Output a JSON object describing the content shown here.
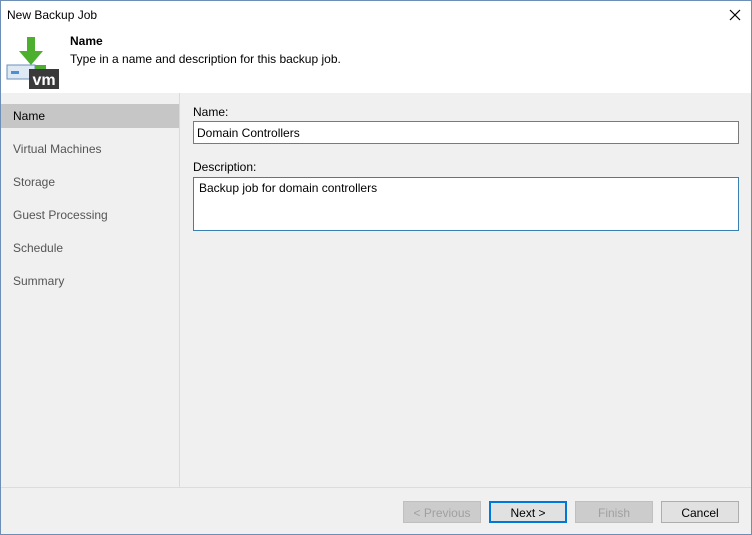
{
  "window": {
    "title": "New Backup Job"
  },
  "header": {
    "title": "Name",
    "subtitle": "Type in a name and description for this backup job."
  },
  "sidebar": {
    "items": [
      {
        "label": "Name",
        "active": true
      },
      {
        "label": "Virtual Machines",
        "active": false
      },
      {
        "label": "Storage",
        "active": false
      },
      {
        "label": "Guest Processing",
        "active": false
      },
      {
        "label": "Schedule",
        "active": false
      },
      {
        "label": "Summary",
        "active": false
      }
    ]
  },
  "form": {
    "name_label": "Name:",
    "name_value": "Domain Controllers",
    "description_label": "Description:",
    "description_value": "Backup job for domain controllers"
  },
  "footer": {
    "previous_label": "< Previous",
    "next_label": "Next >",
    "finish_label": "Finish",
    "cancel_label": "Cancel"
  },
  "colors": {
    "accent": "#0078d7",
    "logo_green": "#4caf2e",
    "logo_vm_bg": "#3a3a3a",
    "sidebar_active": "#c6c6c6"
  },
  "icons": {
    "logo": "veeam-vm-backup-icon",
    "close": "close-icon"
  }
}
